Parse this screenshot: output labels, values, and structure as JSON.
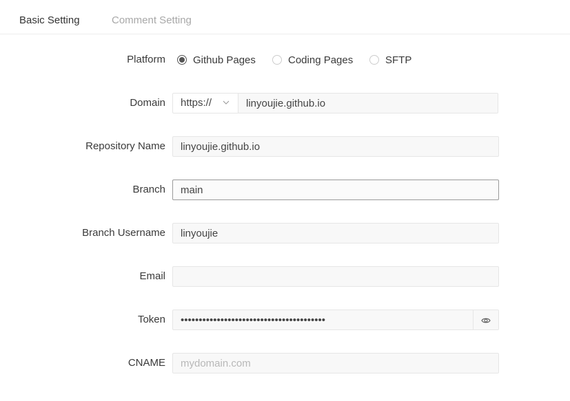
{
  "tabs": {
    "basic": "Basic Setting",
    "comment": "Comment Setting"
  },
  "form": {
    "platform": {
      "label": "Platform",
      "options": [
        "Github Pages",
        "Coding Pages",
        "SFTP"
      ],
      "selected": "Github Pages"
    },
    "domain": {
      "label": "Domain",
      "protocol": "https://",
      "value": "linyoujie.github.io"
    },
    "repository": {
      "label": "Repository Name",
      "value": "linyoujie.github.io"
    },
    "branch": {
      "label": "Branch",
      "value": "main"
    },
    "username": {
      "label": "Branch Username",
      "value": "linyoujie"
    },
    "email": {
      "label": "Email",
      "value": ""
    },
    "token": {
      "label": "Token",
      "value": "••••••••••••••••••••••••••••••••••••••••",
      "toggle_icon": "eye-icon"
    },
    "cname": {
      "label": "CNAME",
      "value": "",
      "placeholder": "mydomain.com"
    }
  },
  "colors": {
    "text": "#333333",
    "inactive_tab": "#a8a8a8",
    "input_bg": "#f8f8f8",
    "input_border": "#e6e6e6",
    "focus_border": "#9a9a9a"
  }
}
